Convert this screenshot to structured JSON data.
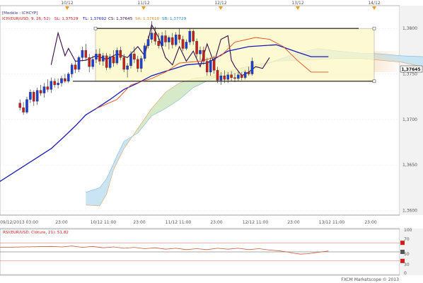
{
  "header": {
    "model_label": "[Modèle : ICHCYP]",
    "indicator_label": "ICH(EUR/USD, 9, 26, 52)",
    "sl_label": "SL: 1,37529",
    "tl_label": "TL: 1,37692",
    "cs_label": "CS: 1,37645",
    "sa_label": "SA: 1,37610",
    "sb_label": "SB: 1,37729"
  },
  "top_time_labels": [
    "10/12",
    "11/12",
    "12/12",
    "13/12",
    "14/12"
  ],
  "bottom_time_labels": [
    "09/12/2013 03:00",
    "23:00",
    "10/12 11:00",
    "23:00",
    "11/12 11:00",
    "23:00",
    "12/12 11:00",
    "23:00",
    "13/12 11:00",
    "23:00"
  ],
  "current_price_label": "1,37645",
  "rsi": {
    "label": "RSI(EUR/USD, Clôture, 21): 51,82",
    "levels": [
      "100",
      "70",
      "50",
      "30",
      "0"
    ]
  },
  "footer": "FXCM Marketscope © 2013",
  "colors": {
    "bullish": "#1d3fd6",
    "bearish": "#c8201c",
    "tenkan": "#e05020",
    "kijun": "#1a1ab8",
    "chikou": "#3a0a4a",
    "cloud_bearish": "#c6e3f2",
    "cloud_bullish": "#d4e9c6",
    "range_box": "#fbf7c4",
    "rsi_line": "#c85a3a"
  },
  "chart_data": [
    {
      "type": "candlestick",
      "title": "ICH(EUR/USD, 9, 26, 52)",
      "ylim": [
        1.3595,
        1.3825
      ],
      "y_ticks": [
        "1,3800",
        "1,3750",
        "1,3700",
        "1,3650",
        "1,3600"
      ],
      "y_tick_values": [
        1.38,
        1.375,
        1.37,
        1.365,
        1.36
      ],
      "range_box": {
        "top": 1.38,
        "bottom": 1.3742
      },
      "ohlc": [
        [
          1.3718,
          1.3722,
          1.371,
          1.3713
        ],
        [
          1.3713,
          1.3719,
          1.3705,
          1.3708
        ],
        [
          1.3708,
          1.3725,
          1.3706,
          1.3722
        ],
        [
          1.3722,
          1.3733,
          1.3718,
          1.373
        ],
        [
          1.373,
          1.3732,
          1.3715,
          1.372
        ],
        [
          1.372,
          1.3735,
          1.3716,
          1.3732
        ],
        [
          1.3732,
          1.3738,
          1.3726,
          1.3729
        ],
        [
          1.3729,
          1.374,
          1.3724,
          1.3736
        ],
        [
          1.3736,
          1.3744,
          1.373,
          1.3733
        ],
        [
          1.3733,
          1.3746,
          1.3729,
          1.3742
        ],
        [
          1.3742,
          1.3745,
          1.3735,
          1.3738
        ],
        [
          1.3738,
          1.3745,
          1.3734,
          1.374
        ],
        [
          1.374,
          1.3748,
          1.3736,
          1.3745
        ],
        [
          1.3745,
          1.375,
          1.374,
          1.3742
        ],
        [
          1.3742,
          1.3752,
          1.374,
          1.375
        ],
        [
          1.375,
          1.3762,
          1.3746,
          1.376
        ],
        [
          1.376,
          1.3765,
          1.3751,
          1.3755
        ],
        [
          1.3755,
          1.377,
          1.3752,
          1.3768
        ],
        [
          1.3768,
          1.378,
          1.3764,
          1.3776
        ],
        [
          1.3776,
          1.3783,
          1.3765,
          1.3768
        ],
        [
          1.3768,
          1.3772,
          1.3752,
          1.3758
        ],
        [
          1.3758,
          1.377,
          1.3755,
          1.3766
        ],
        [
          1.3766,
          1.3777,
          1.3762,
          1.3772
        ],
        [
          1.3772,
          1.3778,
          1.376,
          1.3764
        ],
        [
          1.3764,
          1.3773,
          1.3759,
          1.377
        ],
        [
          1.377,
          1.3773,
          1.3754,
          1.3757
        ],
        [
          1.3757,
          1.3772,
          1.3755,
          1.3769
        ],
        [
          1.3769,
          1.3776,
          1.3758,
          1.3762
        ],
        [
          1.3762,
          1.3779,
          1.376,
          1.3776
        ],
        [
          1.3776,
          1.378,
          1.3765,
          1.3768
        ],
        [
          1.3768,
          1.3772,
          1.3752,
          1.3755
        ],
        [
          1.3755,
          1.3762,
          1.3746,
          1.3759
        ],
        [
          1.3759,
          1.3775,
          1.3756,
          1.3772
        ],
        [
          1.3772,
          1.378,
          1.3762,
          1.3766
        ],
        [
          1.3766,
          1.377,
          1.3752,
          1.3756
        ],
        [
          1.3756,
          1.377,
          1.3752,
          1.3767
        ],
        [
          1.3767,
          1.3784,
          1.3764,
          1.3781
        ],
        [
          1.3781,
          1.3792,
          1.3778,
          1.3788
        ],
        [
          1.3788,
          1.3808,
          1.3784,
          1.3795
        ],
        [
          1.3795,
          1.3802,
          1.3782,
          1.3786
        ],
        [
          1.3786,
          1.3795,
          1.3778,
          1.3781
        ],
        [
          1.3781,
          1.3796,
          1.3778,
          1.3792
        ],
        [
          1.3792,
          1.3798,
          1.378,
          1.3785
        ],
        [
          1.3785,
          1.3792,
          1.3777,
          1.379
        ],
        [
          1.379,
          1.3795,
          1.3778,
          1.3782
        ],
        [
          1.3782,
          1.3796,
          1.378,
          1.3793
        ],
        [
          1.3793,
          1.38,
          1.3784,
          1.3788
        ],
        [
          1.3788,
          1.3792,
          1.3775,
          1.3778
        ],
        [
          1.3778,
          1.3788,
          1.3776,
          1.3785
        ],
        [
          1.3785,
          1.38,
          1.3782,
          1.3797
        ],
        [
          1.3797,
          1.3799,
          1.3782,
          1.3786
        ],
        [
          1.3786,
          1.3789,
          1.3768,
          1.3772
        ],
        [
          1.3772,
          1.378,
          1.3765,
          1.3776
        ],
        [
          1.3776,
          1.378,
          1.376,
          1.3764
        ],
        [
          1.3764,
          1.3768,
          1.3748,
          1.3752
        ],
        [
          1.3752,
          1.3768,
          1.3748,
          1.3765
        ],
        [
          1.3765,
          1.377,
          1.375,
          1.3754
        ],
        [
          1.3754,
          1.3758,
          1.374,
          1.3743
        ],
        [
          1.3743,
          1.3752,
          1.3738,
          1.3748
        ],
        [
          1.3748,
          1.3754,
          1.374,
          1.3744
        ],
        [
          1.3744,
          1.3752,
          1.374,
          1.3749
        ],
        [
          1.3749,
          1.3753,
          1.3742,
          1.3746
        ],
        [
          1.3746,
          1.3751,
          1.3741,
          1.3745
        ],
        [
          1.3745,
          1.3753,
          1.3742,
          1.3749
        ],
        [
          1.3749,
          1.3752,
          1.3743,
          1.3746
        ],
        [
          1.3746,
          1.3754,
          1.3744,
          1.3752
        ],
        [
          1.3752,
          1.3758,
          1.3748,
          1.375
        ],
        [
          1.375,
          1.3768,
          1.3748,
          1.3764
        ]
      ],
      "tenkan": [
        [
          0,
          1.3712
        ],
        [
          6,
          1.3722
        ],
        [
          10,
          1.3738
        ],
        [
          16,
          1.3745
        ],
        [
          20,
          1.3752
        ],
        [
          24,
          1.3762
        ],
        [
          30,
          1.3764
        ],
        [
          36,
          1.377
        ],
        [
          40,
          1.3785
        ],
        [
          46,
          1.379
        ],
        [
          50,
          1.3788
        ],
        [
          54,
          1.378
        ],
        [
          58,
          1.3765
        ],
        [
          62,
          1.3752
        ],
        [
          67,
          1.3752
        ]
      ],
      "kijun": [
        [
          -13,
          1.3668
        ],
        [
          -9,
          1.3682
        ],
        [
          -6,
          1.3693
        ],
        [
          -3,
          1.3705
        ],
        [
          0,
          1.3712
        ],
        [
          4,
          1.3722
        ],
        [
          8,
          1.3733
        ],
        [
          12,
          1.374
        ],
        [
          16,
          1.3748
        ],
        [
          20,
          1.3753
        ],
        [
          26,
          1.376
        ],
        [
          32,
          1.3762
        ],
        [
          38,
          1.3775
        ],
        [
          44,
          1.378
        ],
        [
          52,
          1.3782
        ],
        [
          58,
          1.3774
        ],
        [
          62,
          1.3769
        ],
        [
          67,
          1.3769
        ]
      ],
      "chikou": [
        [
          -13,
          1.376
        ],
        [
          -11,
          1.3795
        ],
        [
          -9,
          1.377
        ],
        [
          -8,
          1.3778
        ],
        [
          -6,
          1.3764
        ],
        [
          -3,
          1.3765
        ],
        [
          0,
          1.377
        ],
        [
          3,
          1.3766
        ],
        [
          6,
          1.3772
        ],
        [
          9,
          1.3768
        ],
        [
          12,
          1.378
        ],
        [
          14,
          1.377
        ],
        [
          16,
          1.3804
        ],
        [
          18,
          1.379
        ],
        [
          20,
          1.3768
        ],
        [
          22,
          1.376
        ],
        [
          24,
          1.378
        ],
        [
          26,
          1.3764
        ],
        [
          28,
          1.3775
        ],
        [
          30,
          1.3758
        ],
        [
          32,
          1.3783
        ],
        [
          34,
          1.3762
        ],
        [
          36,
          1.3788
        ],
        [
          38,
          1.3792
        ],
        [
          39,
          1.3765
        ],
        [
          40,
          1.3758
        ],
        [
          42,
          1.3748
        ],
        [
          44,
          1.3752
        ],
        [
          46,
          1.3758
        ],
        [
          48,
          1.3756
        ],
        [
          50,
          1.3768
        ]
      ],
      "senkou_a": [
        [
          -3,
          1.3606
        ],
        [
          1,
          1.3605
        ],
        [
          3,
          1.3618
        ],
        [
          5,
          1.3645
        ],
        [
          8,
          1.3668
        ],
        [
          12,
          1.369
        ],
        [
          16,
          1.3712
        ],
        [
          20,
          1.373
        ],
        [
          24,
          1.374
        ],
        [
          28,
          1.3745
        ],
        [
          34,
          1.3748
        ],
        [
          40,
          1.3755
        ],
        [
          46,
          1.376
        ],
        [
          52,
          1.3764
        ],
        [
          58,
          1.3765
        ],
        [
          64,
          1.3766
        ],
        [
          70,
          1.3767
        ],
        [
          76,
          1.3767
        ],
        [
          82,
          1.3765
        ],
        [
          88,
          1.3763
        ],
        [
          94,
          1.3758
        ],
        [
          97,
          1.3756
        ]
      ],
      "senkou_b": [
        [
          -3,
          1.362
        ],
        [
          1,
          1.3625
        ],
        [
          3,
          1.3635
        ],
        [
          6,
          1.366
        ],
        [
          8,
          1.3676
        ],
        [
          12,
          1.3685
        ],
        [
          16,
          1.3704
        ],
        [
          20,
          1.3712
        ],
        [
          24,
          1.3722
        ],
        [
          28,
          1.3735
        ],
        [
          34,
          1.3746
        ],
        [
          40,
          1.375
        ],
        [
          46,
          1.3756
        ],
        [
          52,
          1.3765
        ],
        [
          58,
          1.3773
        ],
        [
          64,
          1.3778
        ],
        [
          70,
          1.3775
        ],
        [
          76,
          1.3773
        ],
        [
          82,
          1.3772
        ],
        [
          88,
          1.377
        ],
        [
          94,
          1.3769
        ],
        [
          97,
          1.3769
        ]
      ]
    },
    {
      "type": "line",
      "title": "RSI(EUR/USD, Clôture, 21): 51,82",
      "ylim": [
        0,
        100
      ],
      "levels": [
        100,
        70,
        50,
        30,
        0
      ],
      "values": [
        [
          -13,
          62
        ],
        [
          -10,
          61
        ],
        [
          -7,
          63
        ],
        [
          -4,
          60
        ],
        [
          -1,
          62
        ],
        [
          2,
          59
        ],
        [
          5,
          61
        ],
        [
          8,
          58
        ],
        [
          11,
          60
        ],
        [
          14,
          57
        ],
        [
          17,
          59
        ],
        [
          20,
          56
        ],
        [
          23,
          58
        ],
        [
          26,
          55
        ],
        [
          29,
          57
        ],
        [
          32,
          55
        ],
        [
          35,
          58
        ],
        [
          38,
          56
        ],
        [
          41,
          58
        ],
        [
          44,
          55
        ],
        [
          47,
          57
        ],
        [
          50,
          54
        ],
        [
          53,
          52
        ],
        [
          55,
          50
        ],
        [
          57,
          47
        ],
        [
          59,
          45
        ],
        [
          61,
          46
        ],
        [
          63,
          48
        ],
        [
          65,
          50
        ],
        [
          67,
          51.82
        ]
      ]
    }
  ]
}
